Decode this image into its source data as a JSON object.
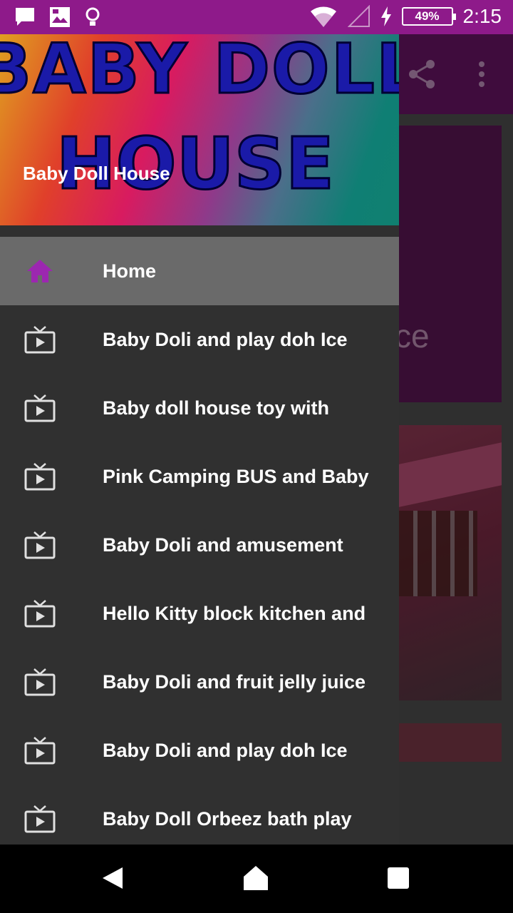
{
  "status_bar": {
    "time": "2:15",
    "battery": "49%",
    "icons": [
      "chat-icon",
      "photo-icon",
      "lightbulb-icon",
      "wifi-icon",
      "signal-icon",
      "charging-icon"
    ]
  },
  "background_app": {
    "card_text": "ce"
  },
  "drawer": {
    "header_title": "Baby Doll House",
    "logo_line1": "BABY DOLL",
    "logo_line2": "HOUSE",
    "items": [
      {
        "label": "Home",
        "icon": "home-icon",
        "selected": true
      },
      {
        "label": "Baby Doli and play doh Ice",
        "icon": "tv-icon"
      },
      {
        "label": "Baby doll house toy with",
        "icon": "tv-icon"
      },
      {
        "label": "Pink Camping BUS and Baby",
        "icon": "tv-icon"
      },
      {
        "label": "Baby Doli and amusement",
        "icon": "tv-icon"
      },
      {
        "label": "Hello Kitty block kitchen and",
        "icon": "tv-icon"
      },
      {
        "label": "Baby Doli and fruit jelly juice",
        "icon": "tv-icon"
      },
      {
        "label": "Baby Doli and play doh Ice",
        "icon": "tv-icon"
      },
      {
        "label": "Baby Doll Orbeez bath play",
        "icon": "tv-icon"
      }
    ]
  },
  "colors": {
    "status_bar": "#8e1a8a",
    "drawer_bg": "#303030",
    "selected_bg": "#6a6a6a",
    "accent": "#9c27b0"
  }
}
